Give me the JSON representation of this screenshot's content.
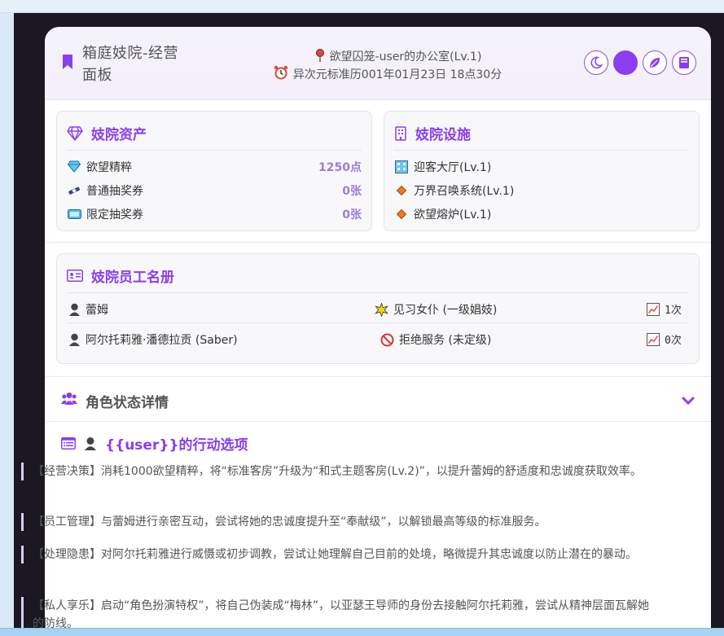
{
  "header": {
    "title": "箱庭妓院-经营面板",
    "location": "欲望囚笼-user的办公室(Lv.1)",
    "datetime": "异次元标准历001年01月23日 18点30分",
    "buttons": [
      "moon-icon",
      "theme-dot",
      "leaf-icon",
      "book-icon"
    ]
  },
  "assets": {
    "title": "妓院资产",
    "items": [
      {
        "icon": "gem-icon",
        "label": "欲望精粹",
        "value": "1250点"
      },
      {
        "icon": "ticket-icon",
        "label": "普通抽奖券",
        "value": "0张"
      },
      {
        "icon": "card-ticket-icon",
        "label": "限定抽奖券",
        "value": "0张"
      }
    ]
  },
  "facilities": {
    "title": "妓院设施",
    "items": [
      {
        "icon": "building-icon",
        "label": "迎客大厅(Lv.1)"
      },
      {
        "icon": "diamond-icon",
        "label": "万界召唤系统(Lv.1)"
      },
      {
        "icon": "diamond-icon",
        "label": "欲望熔炉(Lv.1)"
      }
    ]
  },
  "roster": {
    "title": "妓院员工名册",
    "rows": [
      {
        "name": "蕾姆",
        "status_icon": "sparkle-icon",
        "status": "见习女仆 (一级娼妓)",
        "count": "1次"
      },
      {
        "name": "阿尔托莉雅·潘德拉贡 (Saber)",
        "status_icon": "prohibited-icon",
        "status": "拒绝服务 (未定级)",
        "count": "0次"
      }
    ]
  },
  "status_section": {
    "title": "角色状态详情"
  },
  "actions": {
    "title": "{{user}}的行动选项",
    "items": [
      "【经营决策】消耗1000欲望精粹，将“标准客房”升级为“和式主题客房(Lv.2)”，以提升蕾姆的舒适度和忠诚度获取效率。",
      "【员工管理】与蕾姆进行亲密互动，尝试将她的忠诚度提升至“奉献级”，以解锁最高等级的标准服务。",
      "【处理隐患】对阿尔托莉雅进行威慑或初步调教，尝试让她理解自己目前的处境，略微提升其忠诚度以防止潜在的暴动。",
      "【私人享乐】启动“角色扮演特权”，将自己伪装成“梅林”，以亚瑟王导师的身份去接触阿尔托莉雅，尝试从精神层面瓦解她的防线。"
    ]
  },
  "colors": {
    "accent": "#8a3ef0",
    "value": "#9c7be0",
    "frame": "#1b1821"
  }
}
